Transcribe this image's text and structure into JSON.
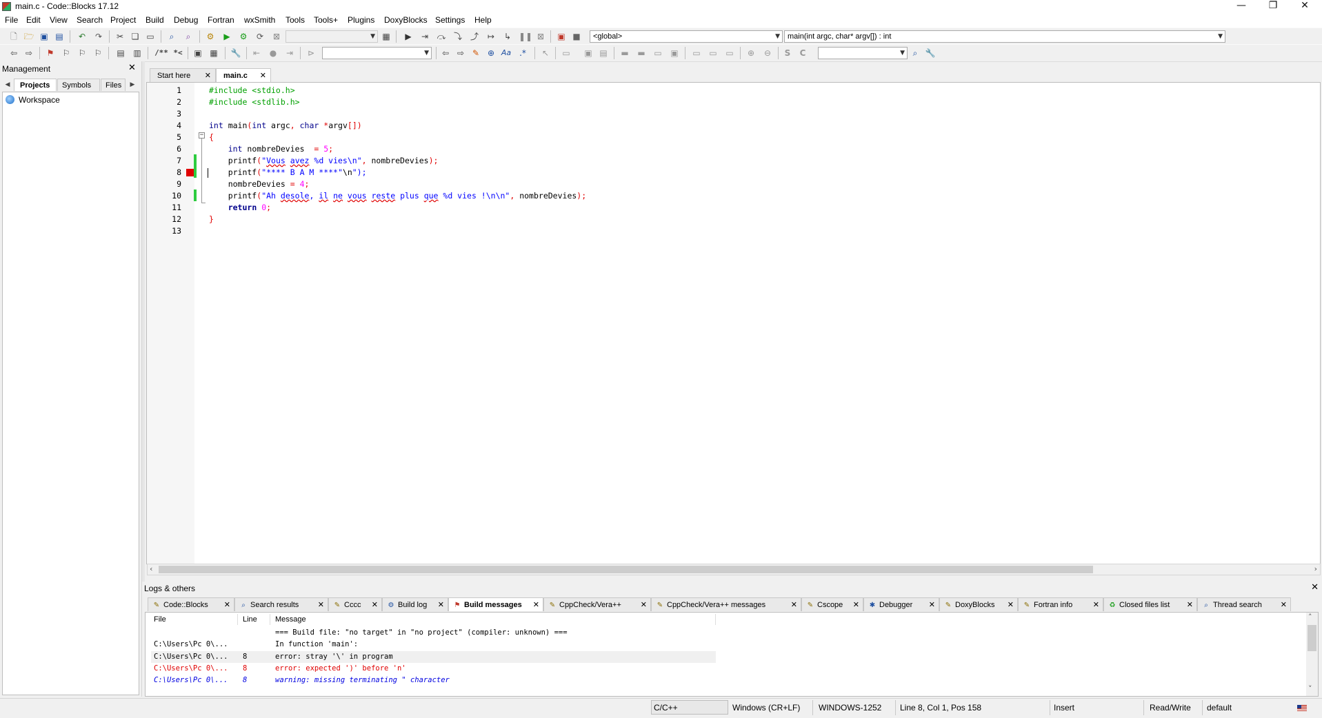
{
  "window": {
    "title": "main.c - Code::Blocks 17.12",
    "controls": [
      "—",
      "❐",
      "✕"
    ]
  },
  "menu": [
    "File",
    "Edit",
    "View",
    "Search",
    "Project",
    "Build",
    "Debug",
    "Fortran",
    "wxSmith",
    "Tools",
    "Tools+",
    "Plugins",
    "DoxyBlocks",
    "Settings",
    "Help"
  ],
  "toolbar": {
    "build_target_combo": "",
    "scope_combo": "<global>",
    "function_combo": "main(int argc, char* argv[]) : int",
    "search_combo": "",
    "symbol_combo": "",
    "doxy_comment_label": "/**",
    "doxy_line_label": "*<",
    "icons": [
      "new-file-icon",
      "open-icon",
      "save-icon",
      "save-all-icon",
      "undo-icon",
      "redo-icon",
      "cut-icon",
      "copy-icon",
      "paste-icon",
      "find-icon",
      "replace-icon",
      "build-icon",
      "run-icon",
      "build-run-icon",
      "rebuild-icon",
      "abort-icon"
    ]
  },
  "management": {
    "title": "Management",
    "tabs": [
      "Projects",
      "Symbols",
      "Files"
    ],
    "active_tab": "Projects",
    "tree": {
      "root": "Workspace"
    }
  },
  "editor": {
    "tabs": [
      {
        "label": "Start here",
        "active": false
      },
      {
        "label": "main.c",
        "active": true
      }
    ],
    "line_numbers": [
      "1",
      "2",
      "3",
      "4",
      "5",
      "6",
      "7",
      "8",
      "9",
      "10",
      "11",
      "12",
      "13"
    ],
    "code_lines": [
      "#include <stdio.h>",
      "#include <stdlib.h>",
      "",
      "int main(int argc, char *argv[])",
      "{",
      "    int nombreDevies  = 5;",
      "    printf(\"Vous avez %d vies\\n\", nombreDevies);",
      "    printf(\"**** B A M ****\"\\n\");",
      "    nombreDevies = 4;",
      "    printf(\"Ah desole, il ne vous reste plus que %d vies !\\n\\n\", nombreDevies);",
      "    return 0;",
      "}",
      ""
    ],
    "error_marker_line": 8,
    "changed_lines": [
      7,
      8,
      10
    ]
  },
  "logs": {
    "title": "Logs & others",
    "tabs": [
      {
        "label": "Code::Blocks",
        "icon": "document-icon",
        "active": false
      },
      {
        "label": "Search results",
        "icon": "search-icon",
        "active": false
      },
      {
        "label": "Cccc",
        "icon": "document-icon",
        "active": false
      },
      {
        "label": "Build log",
        "icon": "gear-icon",
        "active": false
      },
      {
        "label": "Build messages",
        "icon": "flag-icon",
        "active": true
      },
      {
        "label": "CppCheck/Vera++",
        "icon": "document-icon",
        "active": false
      },
      {
        "label": "CppCheck/Vera++ messages",
        "icon": "document-icon",
        "active": false
      },
      {
        "label": "Cscope",
        "icon": "document-icon",
        "active": false
      },
      {
        "label": "Debugger",
        "icon": "bug-icon",
        "active": false
      },
      {
        "label": "DoxyBlocks",
        "icon": "document-icon",
        "active": false
      },
      {
        "label": "Fortran info",
        "icon": "document-icon",
        "active": false
      },
      {
        "label": "Closed files list",
        "icon": "recycle-icon",
        "active": false
      },
      {
        "label": "Thread search",
        "icon": "search-icon",
        "active": false
      }
    ],
    "columns": [
      "File",
      "Line",
      "Message"
    ],
    "rows": [
      {
        "file": "",
        "line": "",
        "message": "=== Build file: \"no target\" in \"no project\" (compiler: unknown) ===",
        "kind": "info"
      },
      {
        "file": "C:\\Users\\Pc 0\\...",
        "line": "",
        "message": "In function 'main':",
        "kind": "info"
      },
      {
        "file": "C:\\Users\\Pc 0\\...",
        "line": "8",
        "message": "error: stray '\\' in program",
        "kind": "selected"
      },
      {
        "file": "C:\\Users\\Pc 0\\...",
        "line": "8",
        "message": "error: expected ')' before 'n'",
        "kind": "error"
      },
      {
        "file": "C:\\Users\\Pc 0\\...",
        "line": "8",
        "message": "warning: missing terminating \" character",
        "kind": "warning"
      }
    ]
  },
  "status": {
    "language": "C/C++",
    "line_endings": "Windows (CR+LF)",
    "encoding": "WINDOWS-1252",
    "position": "Line 8, Col 1, Pos 158",
    "mode": "Insert",
    "access": "Read/Write",
    "profile": "default"
  },
  "colors": {
    "preprocessor": "#00a000",
    "keyword": "#00008b",
    "number": "#ff00ff",
    "string": "#0000ff",
    "operator": "#e00000",
    "changed_line": "#2ecc40",
    "error_marker": "#e00000"
  }
}
